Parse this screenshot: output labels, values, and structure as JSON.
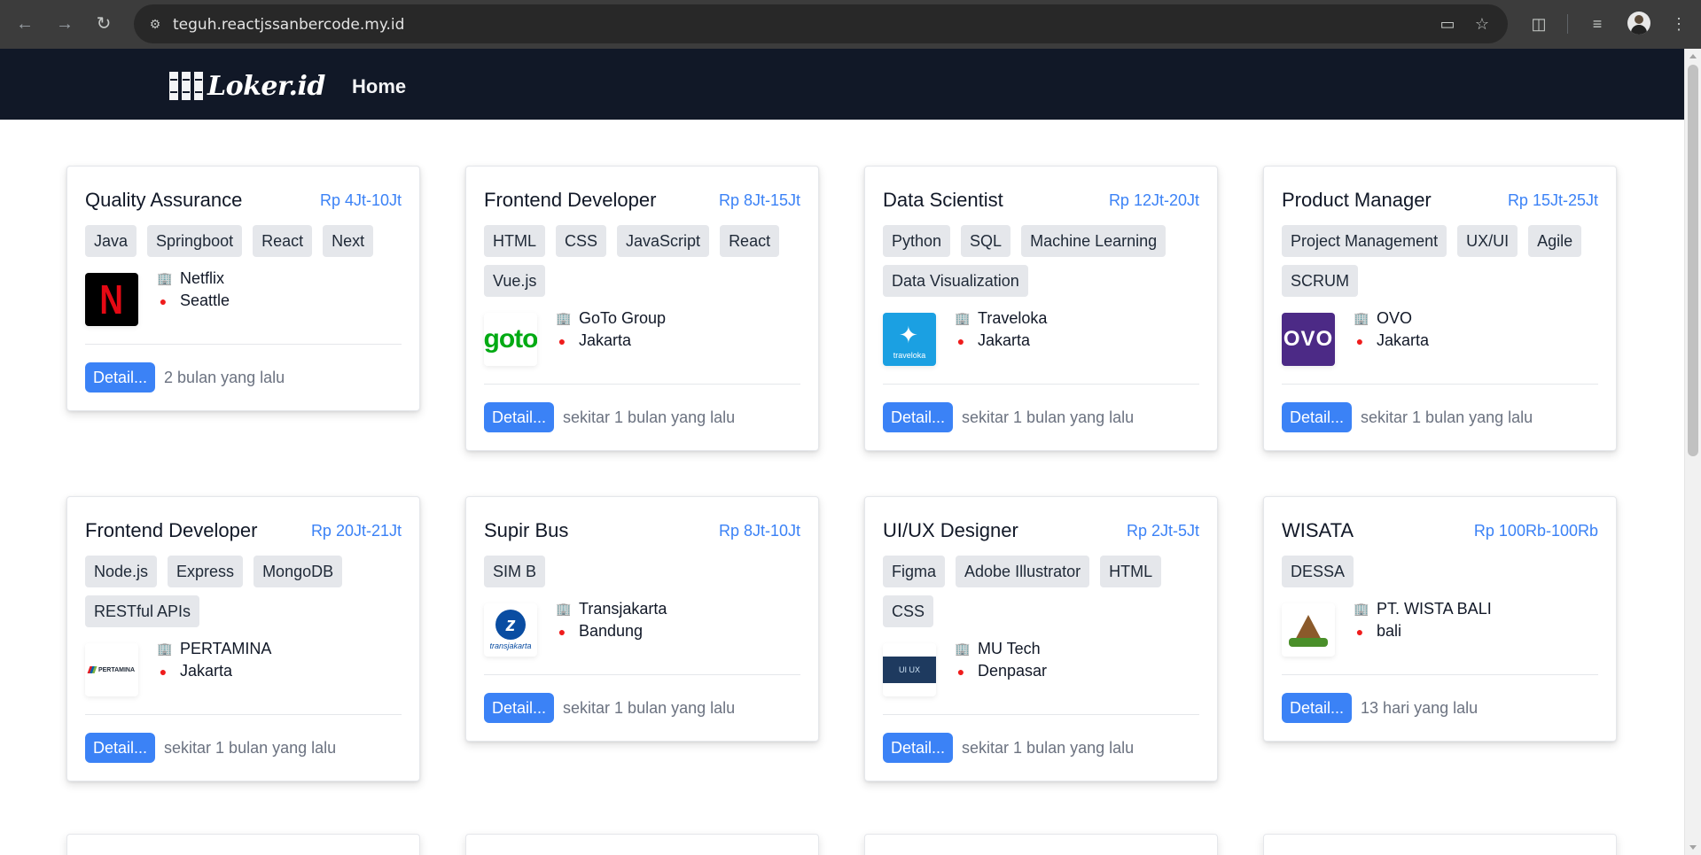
{
  "browser": {
    "url": "teguh.reactjssanbercode.my.id"
  },
  "site": {
    "logo_text": "Loker.id",
    "nav_home": "Home"
  },
  "jobs": [
    {
      "title": "Quality Assurance",
      "salary": "Rp 4Jt-10Jt",
      "tags": [
        "Java",
        "Springboot",
        "React",
        "Next"
      ],
      "company": "Netflix",
      "city": "Seattle",
      "logo_label": "N",
      "detail_label": "Detail...",
      "posted": "2 bulan yang lalu"
    },
    {
      "title": "Frontend Developer",
      "salary": "Rp 8Jt-15Jt",
      "tags": [
        "HTML",
        "CSS",
        "JavaScript",
        "React",
        "Vue.js"
      ],
      "company": "GoTo Group",
      "city": "Jakarta",
      "logo_label": "goto",
      "detail_label": "Detail...",
      "posted": "sekitar 1 bulan yang lalu"
    },
    {
      "title": "Data Scientist",
      "salary": "Rp 12Jt-20Jt",
      "tags": [
        "Python",
        "SQL",
        "Machine Learning",
        "Data Visualization"
      ],
      "company": "Traveloka",
      "city": "Jakarta",
      "logo_label": "traveloka",
      "detail_label": "Detail...",
      "posted": "sekitar 1 bulan yang lalu"
    },
    {
      "title": "Product Manager",
      "salary": "Rp 15Jt-25Jt",
      "tags": [
        "Project Management",
        "UX/UI",
        "Agile",
        "SCRUM"
      ],
      "company": "OVO",
      "city": "Jakarta",
      "logo_label": "OVO",
      "detail_label": "Detail...",
      "posted": "sekitar 1 bulan yang lalu"
    },
    {
      "title": "Frontend Developer",
      "salary": "Rp 20Jt-21Jt",
      "tags": [
        "Node.js",
        "Express",
        "MongoDB",
        "RESTful APIs"
      ],
      "company": "PERTAMINA",
      "city": "Jakarta",
      "logo_label": "PERTAMINA",
      "detail_label": "Detail...",
      "posted": "sekitar 1 bulan yang lalu"
    },
    {
      "title": "Supir Bus",
      "salary": "Rp 8Jt-10Jt",
      "tags": [
        "SIM B"
      ],
      "company": "Transjakarta",
      "city": "Bandung",
      "logo_label": "transjakarta",
      "detail_label": "Detail...",
      "posted": "sekitar 1 bulan yang lalu"
    },
    {
      "title": "UI/UX Designer",
      "salary": "Rp 2Jt-5Jt",
      "tags": [
        "Figma",
        "Adobe Illustrator",
        "HTML",
        "CSS"
      ],
      "company": "MU Tech",
      "city": "Denpasar",
      "logo_label": "UI UX",
      "detail_label": "Detail...",
      "posted": "sekitar 1 bulan yang lalu"
    },
    {
      "title": "WISATA",
      "salary": "Rp 100Rb-100Rb",
      "tags": [
        "DESSA"
      ],
      "company": "PT. WISTA BALI",
      "city": "bali",
      "logo_label": "",
      "detail_label": "Detail...",
      "posted": "13 hari yang lalu"
    }
  ],
  "colors": {
    "navbar_bg": "#111827",
    "accent_blue": "#3b82f6",
    "tag_bg": "#e5e7eb",
    "building_icon": "#2a3bd8",
    "pin_icon": "#ef1c1c"
  },
  "icons": {
    "building": "building-icon",
    "pin": "map-pin-icon"
  }
}
